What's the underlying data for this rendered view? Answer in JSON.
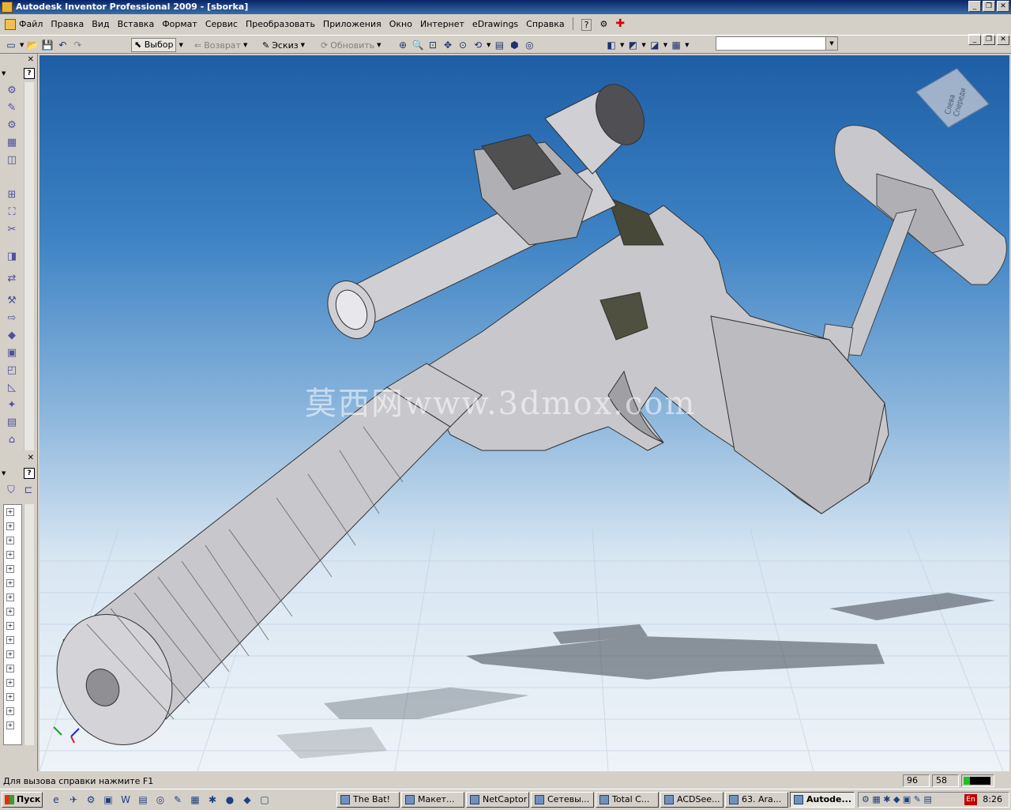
{
  "window": {
    "title": "Autodesk Inventor Professional 2009 - [sborka]"
  },
  "menu": {
    "items": [
      "Файл",
      "Правка",
      "Вид",
      "Вставка",
      "Формат",
      "Сервис",
      "Преобразовать",
      "Приложения",
      "Окно",
      "Интернет",
      "eDrawings",
      "Справка"
    ],
    "help_icon": "?"
  },
  "toolbar": {
    "select_label": "Выбор",
    "return_label": "Возврат",
    "sketch_label": "Эскиз",
    "update_label": "Обновить",
    "combo_value": ""
  },
  "viewport": {
    "viewcube_label": "Слева Спереди",
    "watermark": "莫西网www.3dmox.com",
    "colors": {
      "background_top": "#1e5ea6",
      "background_bottom": "#eef3f8",
      "model": "#c8c8cc"
    }
  },
  "status": {
    "help_text": "Для вызова справки нажмите F1",
    "cell1": "96",
    "cell2": "58"
  },
  "taskbar": {
    "start_label": "Пуск",
    "tasks": [
      {
        "label": "The Bat!"
      },
      {
        "label": "Макет..."
      },
      {
        "label": "NetCaptor"
      },
      {
        "label": "Сетевы..."
      },
      {
        "label": "Total C..."
      },
      {
        "label": "ACDSee..."
      },
      {
        "label": "63. Ara..."
      },
      {
        "label": "Autode..."
      }
    ],
    "lang": "En",
    "clock": "8:26"
  }
}
